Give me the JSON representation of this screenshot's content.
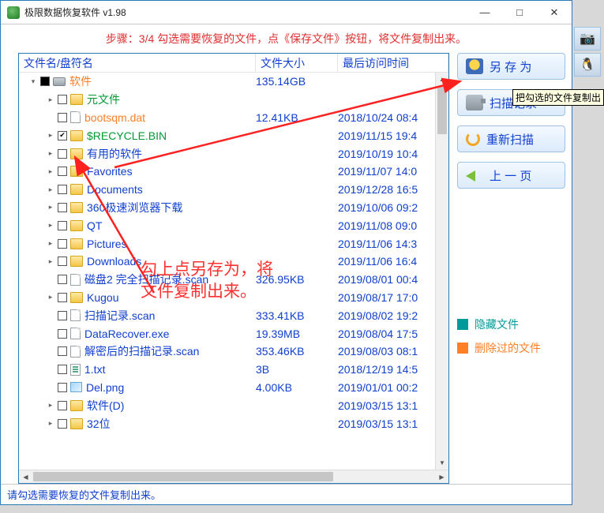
{
  "window": {
    "title": "极限数据恢复软件 v1.98",
    "min": "—",
    "max": "□",
    "close": "✕"
  },
  "step_text": "步骤：3/4 勾选需要恢复的文件，点《保存文件》按钮，将文件复制出来。",
  "columns": {
    "c1": "文件名/盘符名",
    "c2": "文件大小",
    "c3": "最后访问时间"
  },
  "tree": [
    {
      "depth": 0,
      "exp": "▾",
      "cb": "mixed",
      "icon": "drive",
      "name": "软件",
      "cls": "orange",
      "size": "135.14GB",
      "time": ""
    },
    {
      "depth": 1,
      "exp": "▸",
      "cb": "",
      "icon": "folder",
      "name": "元文件",
      "cls": "green",
      "size": "",
      "time": ""
    },
    {
      "depth": 1,
      "exp": "",
      "cb": "",
      "icon": "file",
      "name": "bootsqm.dat",
      "cls": "orange",
      "size": "12.41KB",
      "time": "2018/10/24 08:4"
    },
    {
      "depth": 1,
      "exp": "▸",
      "cb": "checked",
      "icon": "folder",
      "name": "$RECYCLE.BIN",
      "cls": "green",
      "size": "",
      "time": "2019/11/15 19:4"
    },
    {
      "depth": 1,
      "exp": "▸",
      "cb": "",
      "icon": "folder",
      "name": "有用的软件",
      "cls": "",
      "size": "",
      "time": "2019/10/19 10:4"
    },
    {
      "depth": 1,
      "exp": "▸",
      "cb": "",
      "icon": "folder",
      "name": "Favorites",
      "cls": "",
      "size": "",
      "time": "2019/11/07 14:0"
    },
    {
      "depth": 1,
      "exp": "▸",
      "cb": "",
      "icon": "folder",
      "name": "Documents",
      "cls": "",
      "size": "",
      "time": "2019/12/28 16:5"
    },
    {
      "depth": 1,
      "exp": "▸",
      "cb": "",
      "icon": "folder",
      "name": "360极速浏览器下载",
      "cls": "",
      "size": "",
      "time": "2019/10/06 09:2"
    },
    {
      "depth": 1,
      "exp": "▸",
      "cb": "",
      "icon": "folder",
      "name": "QT",
      "cls": "",
      "size": "",
      "time": "2019/11/08 09:0"
    },
    {
      "depth": 1,
      "exp": "▸",
      "cb": "",
      "icon": "folder",
      "name": "Pictures",
      "cls": "",
      "size": "",
      "time": "2019/11/06 14:3"
    },
    {
      "depth": 1,
      "exp": "▸",
      "cb": "",
      "icon": "folder",
      "name": "Downloads",
      "cls": "",
      "size": "",
      "time": "2019/11/06 16:4"
    },
    {
      "depth": 1,
      "exp": "",
      "cb": "",
      "icon": "file",
      "name": "磁盘2 完全扫描记录.scan",
      "cls": "",
      "size": "326.95KB",
      "time": "2019/08/01 00:4"
    },
    {
      "depth": 1,
      "exp": "▸",
      "cb": "",
      "icon": "folder",
      "name": "Kugou",
      "cls": "",
      "size": "",
      "time": "2019/08/17 17:0"
    },
    {
      "depth": 1,
      "exp": "",
      "cb": "",
      "icon": "file",
      "name": "扫描记录.scan",
      "cls": "",
      "size": "333.41KB",
      "time": "2019/08/02 19:2"
    },
    {
      "depth": 1,
      "exp": "",
      "cb": "",
      "icon": "file",
      "name": "DataRecover.exe",
      "cls": "",
      "size": "19.39MB",
      "time": "2019/08/04 17:5"
    },
    {
      "depth": 1,
      "exp": "",
      "cb": "",
      "icon": "file",
      "name": "解密后的扫描记录.scan",
      "cls": "",
      "size": "353.46KB",
      "time": "2019/08/03 08:1"
    },
    {
      "depth": 1,
      "exp": "",
      "cb": "",
      "icon": "txt",
      "name": "1.txt",
      "cls": "",
      "size": "3B",
      "time": "2018/12/19 14:5"
    },
    {
      "depth": 1,
      "exp": "",
      "cb": "",
      "icon": "img",
      "name": "Del.png",
      "cls": "",
      "size": "4.00KB",
      "time": "2019/01/01 00:2"
    },
    {
      "depth": 1,
      "exp": "▸",
      "cb": "",
      "icon": "folder",
      "name": "软件(D)",
      "cls": "",
      "size": "",
      "time": "2019/03/15 13:1"
    },
    {
      "depth": 1,
      "exp": "▸",
      "cb": "",
      "icon": "folder",
      "name": "32位",
      "cls": "",
      "size": "",
      "time": "2019/03/15 13:1"
    }
  ],
  "buttons": {
    "save_as": "另 存 为",
    "scan_log": "扫描记录",
    "rescan": "重新扫描",
    "prev": "上 一 页"
  },
  "legend": {
    "hidden": "隐藏文件",
    "deleted": "删除过的文件"
  },
  "status": "请勾选需要恢复的文件复制出来。",
  "annotation": "勾上点另存为，将\n文件复制出来。",
  "tooltip": "把勾选的文件复制出",
  "float": {
    "i1": "📷",
    "i2": "🐧"
  }
}
